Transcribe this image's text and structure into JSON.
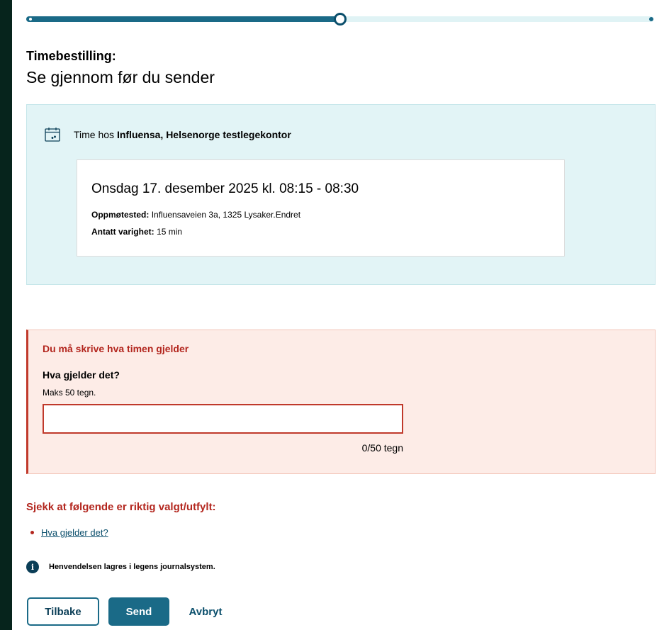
{
  "progress": {
    "fraction": 0.5
  },
  "heading": {
    "lead": "Timebestilling:",
    "title": "Se gjennom før du sender"
  },
  "appointment": {
    "prefix": "Time hos",
    "provider": "Influensa, Helsenorge testlegekontor",
    "datetime": "Onsdag 17. desember 2025 kl. 08:15 - 08:30",
    "location_label": "Oppmøtested:",
    "location_value": "Influensaveien 3a, 1325 Lysaker.Endret",
    "duration_label": "Antatt varighet:",
    "duration_value": "15 min",
    "icon": "calendar-icon"
  },
  "form": {
    "error_message": "Du må skrive hva timen gjelder",
    "label": "Hva gjelder det?",
    "hint": "Maks 50 tegn.",
    "value": "",
    "counter": "0/50 tegn"
  },
  "summary": {
    "title": "Sjekk at følgende er riktig valgt/utfylt:",
    "items": [
      "Hva gjelder det?"
    ]
  },
  "info": {
    "text": "Henvendelsen lagres i legens journalsystem.",
    "icon": "info-icon"
  },
  "buttons": {
    "back": "Tilbake",
    "send": "Send",
    "cancel": "Avbryt"
  },
  "colors": {
    "primary": "#1a6a87",
    "dark": "#0b3e57",
    "error": "#b3261e",
    "panel": "#e2f4f6",
    "error_bg": "#fdece7"
  }
}
